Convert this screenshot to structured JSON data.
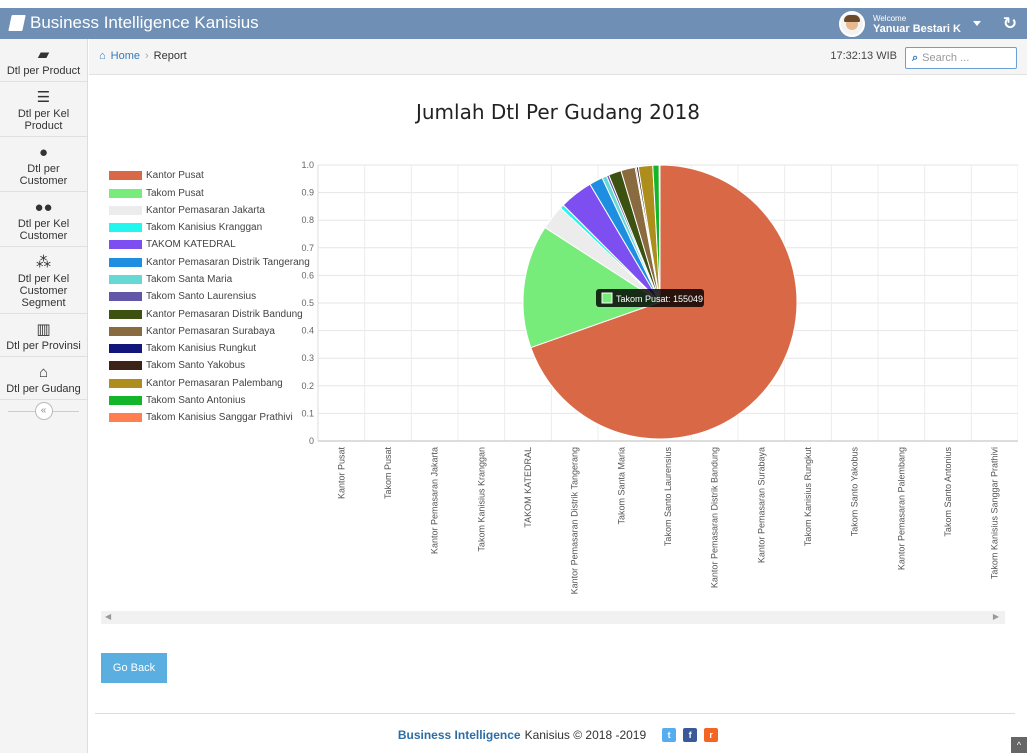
{
  "app": {
    "title": "Business Intelligence Kanisius"
  },
  "user": {
    "welcome": "Welcome",
    "name": "Yanuar Bestari K"
  },
  "sidebar": {
    "items": [
      {
        "label": "Dtl per Product",
        "icon": "book-icon"
      },
      {
        "label": "Dtl per Kel Product",
        "icon": "list-icon"
      },
      {
        "label": "Dtl per Customer",
        "icon": "user-icon"
      },
      {
        "label": "Dtl per Kel Customer",
        "icon": "users-icon"
      },
      {
        "label": "Dtl per Kel Customer Segment",
        "icon": "sitemap-icon"
      },
      {
        "label": "Dtl per Provinsi",
        "icon": "map-icon"
      },
      {
        "label": "Dtl per Gudang",
        "icon": "home-icon"
      }
    ],
    "collapse_label": "«"
  },
  "breadcrumb": {
    "home": "Home",
    "current": "Report"
  },
  "header": {
    "time": "17:32:13 WIB",
    "search_placeholder": "Search ..."
  },
  "chart_data": {
    "type": "pie",
    "title": "Jumlah Dtl Per Gudang 2018",
    "categories": [
      "Kantor Pusat",
      "Takom Pusat",
      "Kantor Pemasaran Jakarta",
      "Takom Kanisius Kranggan",
      "TAKOM KATEDRAL",
      "Kantor Pemasaran Distrik Tangerang",
      "Takom Santa Maria",
      "Takom Santo Laurensius",
      "Kantor Pemasaran Distrik Bandung",
      "Kantor Pemasaran Surabaya",
      "Takom Kanisius Rungkut",
      "Takom Santo Yakobus",
      "Kantor Pemasaran Palembang",
      "Takom Santo Antonius",
      "Takom Kanisius Sanggar Prathivi"
    ],
    "values": [
      742000,
      155049,
      31000,
      5000,
      42000,
      17000,
      6000,
      3000,
      16000,
      18000,
      1500,
      2500,
      18000,
      8000,
      1000
    ],
    "colors": [
      "#d96846",
      "#78ec7a",
      "#ececec",
      "#22f6ee",
      "#7d4ff0",
      "#1e8fe0",
      "#66d9d5",
      "#6256a8",
      "#3d5110",
      "#8a6a3f",
      "#12157a",
      "#3c2318",
      "#ad8e1c",
      "#13b52a",
      "#ff7f50"
    ],
    "y_ticks": [
      "1.0",
      "0.9",
      "0.8",
      "0.7",
      "0.6",
      "0.5",
      "0.4",
      "0.3",
      "0.2",
      "0.1",
      "0"
    ],
    "ylim": [
      0,
      1
    ],
    "grid": true,
    "legend_position": "left",
    "tooltip": "Takom Pusat: 155049"
  },
  "actions": {
    "go_back": "Go Back"
  },
  "footer": {
    "brand": "Business Intelligence",
    "rest": "Kanisius © 2018 -2019"
  }
}
